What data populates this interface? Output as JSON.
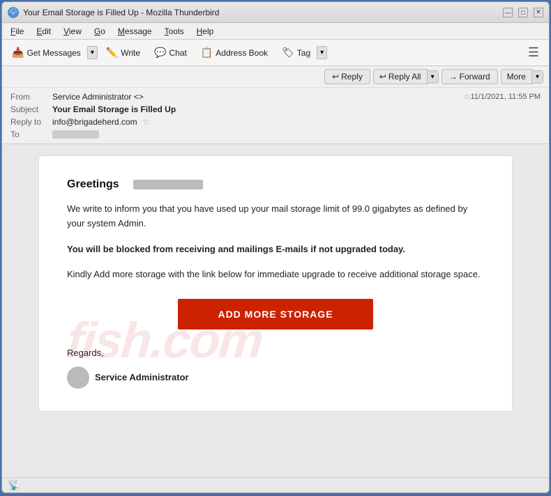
{
  "window": {
    "title": "Your Email Storage is Filled Up - Mozilla Thunderbird",
    "icon": "🌩"
  },
  "window_controls": {
    "minimize": "—",
    "maximize": "□",
    "close": "✕"
  },
  "menu": {
    "items": [
      "File",
      "Edit",
      "View",
      "Go",
      "Message",
      "Tools",
      "Help"
    ]
  },
  "toolbar": {
    "get_messages_label": "Get Messages",
    "write_label": "Write",
    "chat_label": "Chat",
    "address_book_label": "Address Book",
    "tag_label": "Tag"
  },
  "action_bar": {
    "reply_label": "Reply",
    "reply_all_label": "Reply All",
    "forward_label": "Forward",
    "more_label": "More"
  },
  "email_meta": {
    "from_label": "From",
    "from_value": "Service Administrator <>",
    "subject_label": "Subject",
    "subject_value": "Your Email Storage is Filled Up",
    "date_value": "11/1/2021, 11:55 PM",
    "reply_to_label": "Reply to",
    "reply_to_value": "info@brigadeherd.com",
    "to_label": "To",
    "to_value": ""
  },
  "email_body": {
    "greeting": "Greetings",
    "para1": "We write to inform you that you have used up your mail storage limit of 99.0 gigabytes as defined by your system Admin.",
    "para2_bold": "You will be blocked from receiving and mailings E-mails if not upgraded today.",
    "para3": "Kindly Add more storage with the link below for immediate upgrade to receive additional storage space.",
    "cta_button": "ADD MORE STORAGE",
    "regards": "Regards,",
    "sender_name": "Service Administrator",
    "watermark": "fish.com"
  },
  "status_bar": {
    "icon": "📡"
  }
}
